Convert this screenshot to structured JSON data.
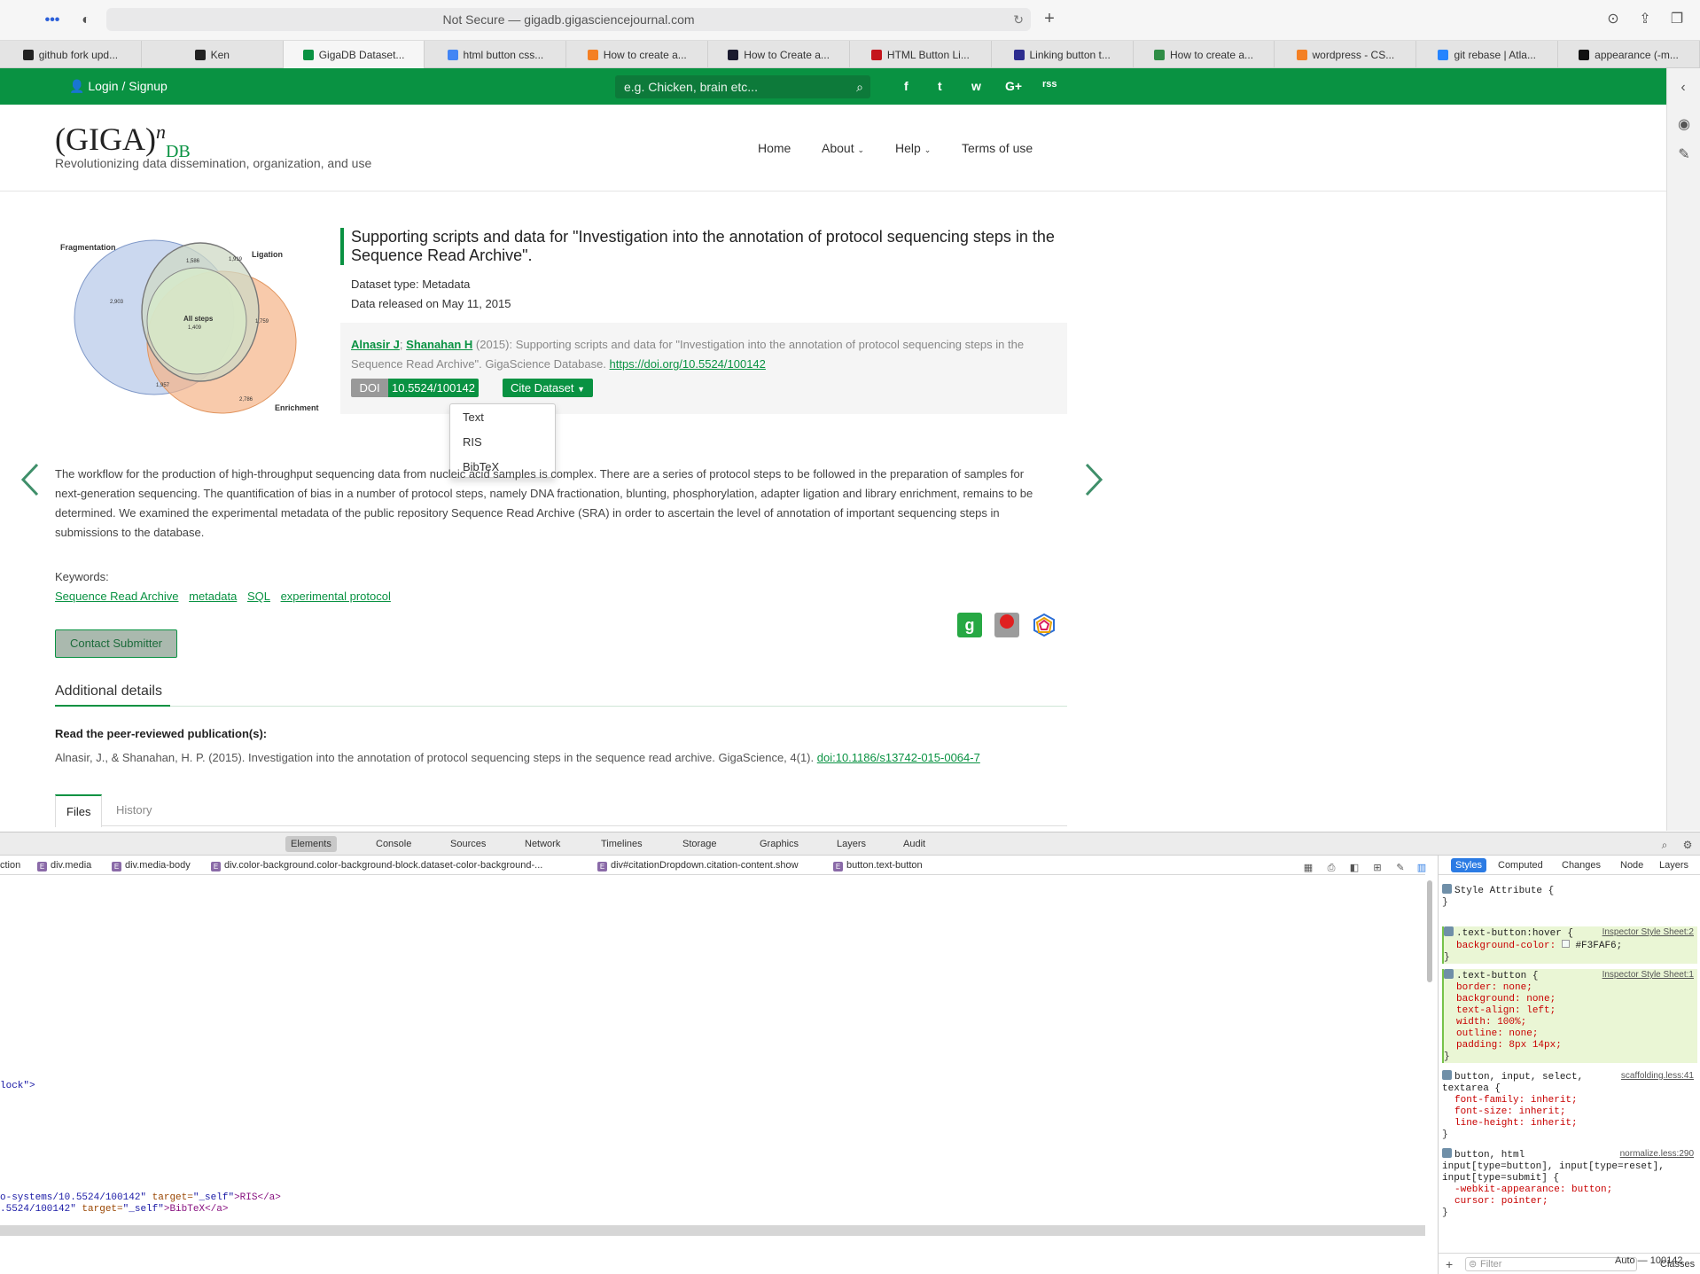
{
  "browser": {
    "url_text": "Not Secure — gigadb.gigasciencejournal.com",
    "tabs": [
      {
        "label": "github fork upd...",
        "color": "#222222"
      },
      {
        "label": "Ken",
        "color": "#222222"
      },
      {
        "label": "GigaDB Dataset...",
        "color": "#099242"
      },
      {
        "label": "html button css...",
        "color": "#4285f4"
      },
      {
        "label": "How to create a...",
        "color": "#f48024"
      },
      {
        "label": "How to Create a...",
        "color": "#1a1a2e"
      },
      {
        "label": "HTML Button Li...",
        "color": "#c4151c"
      },
      {
        "label": "Linking button t...",
        "color": "#2d2d8f"
      },
      {
        "label": "How to create a...",
        "color": "#2f8d46"
      },
      {
        "label": "wordpress - CS...",
        "color": "#f48024"
      },
      {
        "label": "git rebase | Atla...",
        "color": "#2684ff"
      },
      {
        "label": "appearance (-m...",
        "color": "#111111"
      }
    ],
    "active_tab_index": 2
  },
  "site": {
    "login_label": "Login / Signup",
    "search_placeholder": "e.g. Chicken, brain etc...",
    "social": [
      "f",
      "t",
      "w",
      "G+",
      "rss"
    ],
    "logo_main": "(GIGA)",
    "logo_sup": "n",
    "logo_sub": "DB",
    "tagline": "Revolutionizing data dissemination, organization, and use",
    "nav": {
      "home": "Home",
      "about": "About",
      "help": "Help",
      "terms": "Terms of use"
    },
    "brand_green": "#099242"
  },
  "venn": {
    "labels": {
      "fragmentation": "Fragmentation",
      "ligation": "Ligation",
      "enrichment": "Enrichment",
      "all_steps": "All steps"
    },
    "counts": {
      "frag_only": "2,903",
      "frag_lig": "1,586",
      "lig_only": "1,919",
      "all": "1,409",
      "lig_enr": "1,759",
      "frag_enr": "1,957",
      "enr_only": "2,786"
    }
  },
  "dataset": {
    "title": "Supporting scripts and data for \"Investigation into the annotation of protocol sequencing steps in the Sequence Read Archive\".",
    "type": "Dataset type: Metadata",
    "released": "Data released on May 11, 2015",
    "citation": {
      "author1": "Alnasir J",
      "sep": "; ",
      "author2": "Shanahan H",
      "rest": " (2015): Supporting scripts and data for \"Investigation into the annotation of protocol sequencing steps in the Sequence Read Archive\". GigaScience Database. ",
      "doi_url": "https://doi.org/10.5524/100142"
    },
    "doi_label": "DOI",
    "doi_value": "10.5524/100142",
    "cite_button": "Cite Dataset",
    "cite_options": [
      "Text",
      "RIS",
      "BibTeX"
    ],
    "description": "The workflow for the production of high-throughput sequencing data from nucleic acid samples is complex. There are a series of protocol steps to be followed in the preparation of samples for next-generation sequencing. The quantification of bias in a number of protocol steps, namely DNA fractionation, blunting, phosphorylation, adapter ligation and library enrichment, remains to be determined. We examined the experimental metadata of the public repository Sequence Read Archive (SRA) in order to ascertain the level of annotation of important sequencing steps in submissions to the database.",
    "keywords_label": "Keywords:",
    "keywords": [
      "Sequence Read Archive",
      "metadata",
      "SQL",
      "experimental protocol"
    ],
    "contact_button": "Contact Submitter",
    "additional_title": "Additional details",
    "peer_label": "Read the peer-reviewed publication(s):",
    "publication_text": "Alnasir, J., & Shanahan, H. P. (2015). Investigation into the annotation of protocol sequencing steps in the sequence read archive. GigaScience, 4(1). ",
    "publication_doi": "doi:10.1186/s13742-015-0064-7",
    "content_tabs": [
      "Files",
      "History"
    ]
  },
  "devtools": {
    "tabs": [
      "Elements",
      "Console",
      "Sources",
      "Network",
      "Timelines",
      "Storage",
      "Graphics",
      "Layers",
      "Audit"
    ],
    "breadcrumbs": [
      "ction",
      "div.media",
      "div.media-body",
      "div.color-background.color-background-block.dataset-color-background-...",
      "div#citationDropdown.citation-content.show",
      "button.text-button"
    ],
    "code_lines": {
      "line1": "lock\">",
      "line2_pre": "o-systems/10.5524/100142\" ",
      "line2_attr": "target=",
      "line2_val": "\"_self\"",
      "line2_post": ">RIS</a>",
      "line3_pre": ".5524/100142\" ",
      "line3_attr": "target=",
      "line3_val": "\"_self\"",
      "line3_post": ">BibTeX</a>"
    },
    "styles_tabs": [
      "Styles",
      "Computed",
      "Changes",
      "Node",
      "Layers"
    ],
    "style_attribute": "Style Attribute {",
    "hover_rule": {
      "selector": ".text-button:hover {",
      "source": "Inspector Style Sheet:2",
      "prop": "background-color:",
      "value": "#F3FAF6;"
    },
    "text_button_rule": {
      "selector": ".text-button {",
      "source": "Inspector Style Sheet:1",
      "props": [
        "border: none;",
        "background: none;",
        "text-align: left;",
        "width: 100%;",
        "outline: none;",
        "padding: 8px 14px;"
      ]
    },
    "scaffold_rule": {
      "selector": "button, input, select,",
      "selector2": "textarea {",
      "source": "scaffolding.less:41",
      "props": [
        "font-family: inherit;",
        "font-size: inherit;",
        "line-height: inherit;"
      ]
    },
    "normalize_rule": {
      "selector": "button, html",
      "selector2": "input[type=button], input[type=reset],",
      "selector3": "input[type=submit] {",
      "source": "normalize.less:290",
      "props": [
        "-webkit-appearance: button;",
        "cursor: pointer;"
      ]
    },
    "filter_placeholder": "Filter",
    "classes_label": "Classes",
    "status": "Auto — 100142"
  }
}
